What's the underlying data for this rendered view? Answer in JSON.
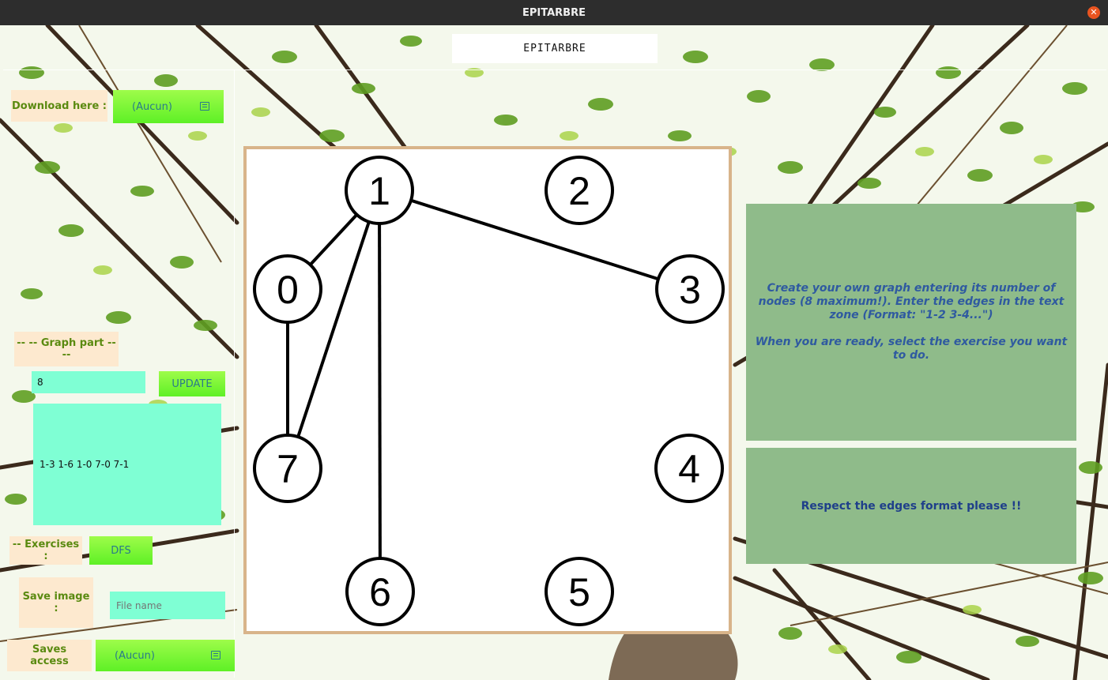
{
  "window": {
    "title": "EPITARBRE",
    "close_glyph": "✕"
  },
  "app": {
    "title": "EPITARBRE"
  },
  "download": {
    "label": "Download here :",
    "value": "(Aucun)",
    "icon": "folder-icon"
  },
  "graph_part": {
    "label": "-- -- Graph part -- --",
    "node_count": "8",
    "update_label": "UPDATE",
    "edges_text": "1-3 1-6 1-0 7-0 7-1"
  },
  "exercises": {
    "label": "-- Exercises :",
    "value": "DFS"
  },
  "save_image": {
    "label": "Save image :",
    "placeholder": "File name"
  },
  "saves_access": {
    "label": "Saves access",
    "value": "(Aucun)",
    "icon": "folder-icon"
  },
  "graph": {
    "nodes": [
      {
        "id": "1",
        "label": "1"
      },
      {
        "id": "2",
        "label": "2"
      },
      {
        "id": "0",
        "label": "0"
      },
      {
        "id": "3",
        "label": "3"
      },
      {
        "id": "7",
        "label": "7"
      },
      {
        "id": "4",
        "label": "4"
      },
      {
        "id": "6",
        "label": "6"
      },
      {
        "id": "5",
        "label": "5"
      }
    ],
    "edges": [
      [
        "1",
        "0"
      ],
      [
        "1",
        "3"
      ],
      [
        "1",
        "7"
      ],
      [
        "1",
        "6"
      ],
      [
        "0",
        "7"
      ]
    ]
  },
  "info": {
    "line1": "Create your own graph entering its number of nodes (8 maximum!). Enter the edges in the text zone (Format: \"1-2 3-4...\")",
    "line2": "When you are ready, select the exercise you want to do."
  },
  "warning": {
    "text": "Respect the edges format please !!"
  },
  "colors": {
    "accent_green": "#5ef026",
    "aqua": "#7fffd4",
    "panel": "#8fbb8a",
    "label_bg": "#fde9cf"
  }
}
